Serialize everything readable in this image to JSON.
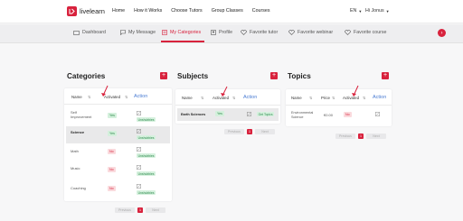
{
  "brand": {
    "name": "livelearn",
    "color": "#d8223d"
  },
  "topnav": [
    "Home",
    "How it Works",
    "Choose Tutors",
    "Group Classes",
    "Courses"
  ],
  "lang": "EN",
  "user_greeting": "Hi Jonus",
  "subnav": [
    {
      "label": "Dashboard",
      "icon": "dashboard-icon"
    },
    {
      "label": "My Message",
      "icon": "message-icon"
    },
    {
      "label": "My Categories",
      "icon": "categories-icon",
      "active": true
    },
    {
      "label": "Profile",
      "icon": "profile-icon"
    },
    {
      "label": "Favorite tutor",
      "icon": "heart-icon"
    },
    {
      "label": "Favorite webinar",
      "icon": "heart-icon"
    },
    {
      "label": "Favorite course",
      "icon": "heart-icon"
    }
  ],
  "categories": {
    "title": "Categories",
    "add": "+",
    "headers": {
      "name": "Name",
      "activated": "Activated",
      "action": "Action"
    },
    "rows": [
      {
        "name": "Self Improvement",
        "activated": "Yes",
        "tag": "Unshubbies",
        "selected": false
      },
      {
        "name": "Science",
        "activated": "Yes",
        "tag": "Unshubbies",
        "selected": true
      },
      {
        "name": "Math",
        "activated": "No",
        "tag": "Unshubbies",
        "selected": false
      },
      {
        "name": "Music",
        "activated": "No",
        "tag": "Unshubbies",
        "selected": false
      },
      {
        "name": "Coaching",
        "activated": "No",
        "tag": "Unshubbies",
        "selected": false
      }
    ],
    "pager": {
      "prev": "Previous",
      "current": "1",
      "next": "Next"
    }
  },
  "subjects": {
    "title": "Subjects",
    "add": "+",
    "headers": {
      "name": "Name",
      "activated": "Activated",
      "action": "Action"
    },
    "rows": [
      {
        "name": "Earth Sciences",
        "activated": "Yes",
        "tag": "Get Topics"
      }
    ],
    "pager": {
      "prev": "Previous",
      "current": "1",
      "next": "Next"
    }
  },
  "topics": {
    "title": "Topics",
    "add": "+",
    "headers": {
      "name": "Name",
      "price": "Price",
      "activated": "Activated",
      "action": "Action"
    },
    "rows": [
      {
        "name": "Environmental Science",
        "price": "€0.00",
        "activated": "No"
      }
    ],
    "pager": {
      "prev": "Previous",
      "current": "1",
      "next": "Next"
    }
  }
}
